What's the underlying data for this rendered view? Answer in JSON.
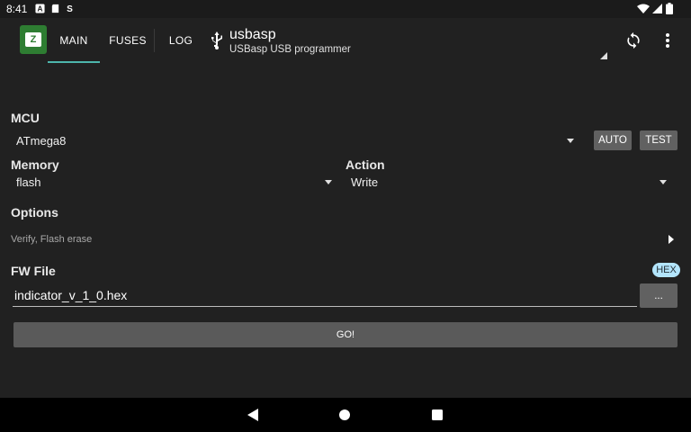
{
  "status_bar": {
    "time": "8:41"
  },
  "tabs": [
    {
      "label": "MAIN",
      "active": true
    },
    {
      "label": "FUSES",
      "active": false
    },
    {
      "label": "LOG",
      "active": false
    }
  ],
  "device": {
    "name": "usbasp",
    "description": "USBasp USB programmer"
  },
  "icons": [
    "usb-icon",
    "sync-icon",
    "more-vert-icon",
    "app-logo-icon"
  ],
  "mcu": {
    "label": "MCU",
    "value": "ATmega8",
    "auto_label": "AUTO",
    "test_label": "TEST"
  },
  "memory": {
    "label": "Memory",
    "value": "flash"
  },
  "action": {
    "label": "Action",
    "value": "Write"
  },
  "options": {
    "label": "Options",
    "value": "Verify, Flash erase"
  },
  "fw_file": {
    "label": "FW File",
    "badge": "HEX",
    "value": "indicator_v_1_0.hex",
    "browse_label": "..."
  },
  "go_label": "GO!",
  "colors": {
    "background": "#212121",
    "accent": "#4db6ac",
    "button": "#616161",
    "badge": "#b3e5fc",
    "app_icon": "#2e7d32"
  }
}
